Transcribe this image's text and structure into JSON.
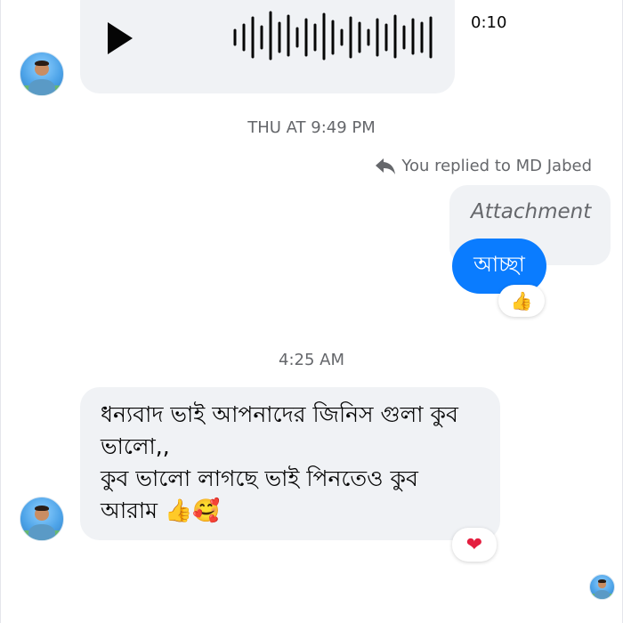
{
  "conversation": {
    "contact_name": "MD Jabed",
    "voice_message": {
      "duration": "0:10",
      "play_icon": "play-icon",
      "waveform_icon": "waveform-icon"
    },
    "timestamp_1": "THU AT 9:49 PM",
    "reply_note": "You replied to MD Jabed",
    "reply_icon": "reply-arrow-icon",
    "attachment_label": "Attachment",
    "sent_message": "আচ্ছা",
    "sent_reaction": "👍",
    "timestamp_2": "4:25 AM",
    "incoming_message_lines": [
      "ধন্যবাদ ভাই আপনাদের জিনিস গুলা কুব",
      "ভালো,,",
      "কুব ভালো লাগছে ভাই পিনতেও কুব",
      "আরাম 👍🥰"
    ],
    "incoming_reaction": "❤",
    "colors": {
      "sent_bubble": "#0a7cff",
      "received_bubble": "#f0f2f5",
      "muted_text": "#65676b",
      "heart": "#e41e3f"
    }
  }
}
